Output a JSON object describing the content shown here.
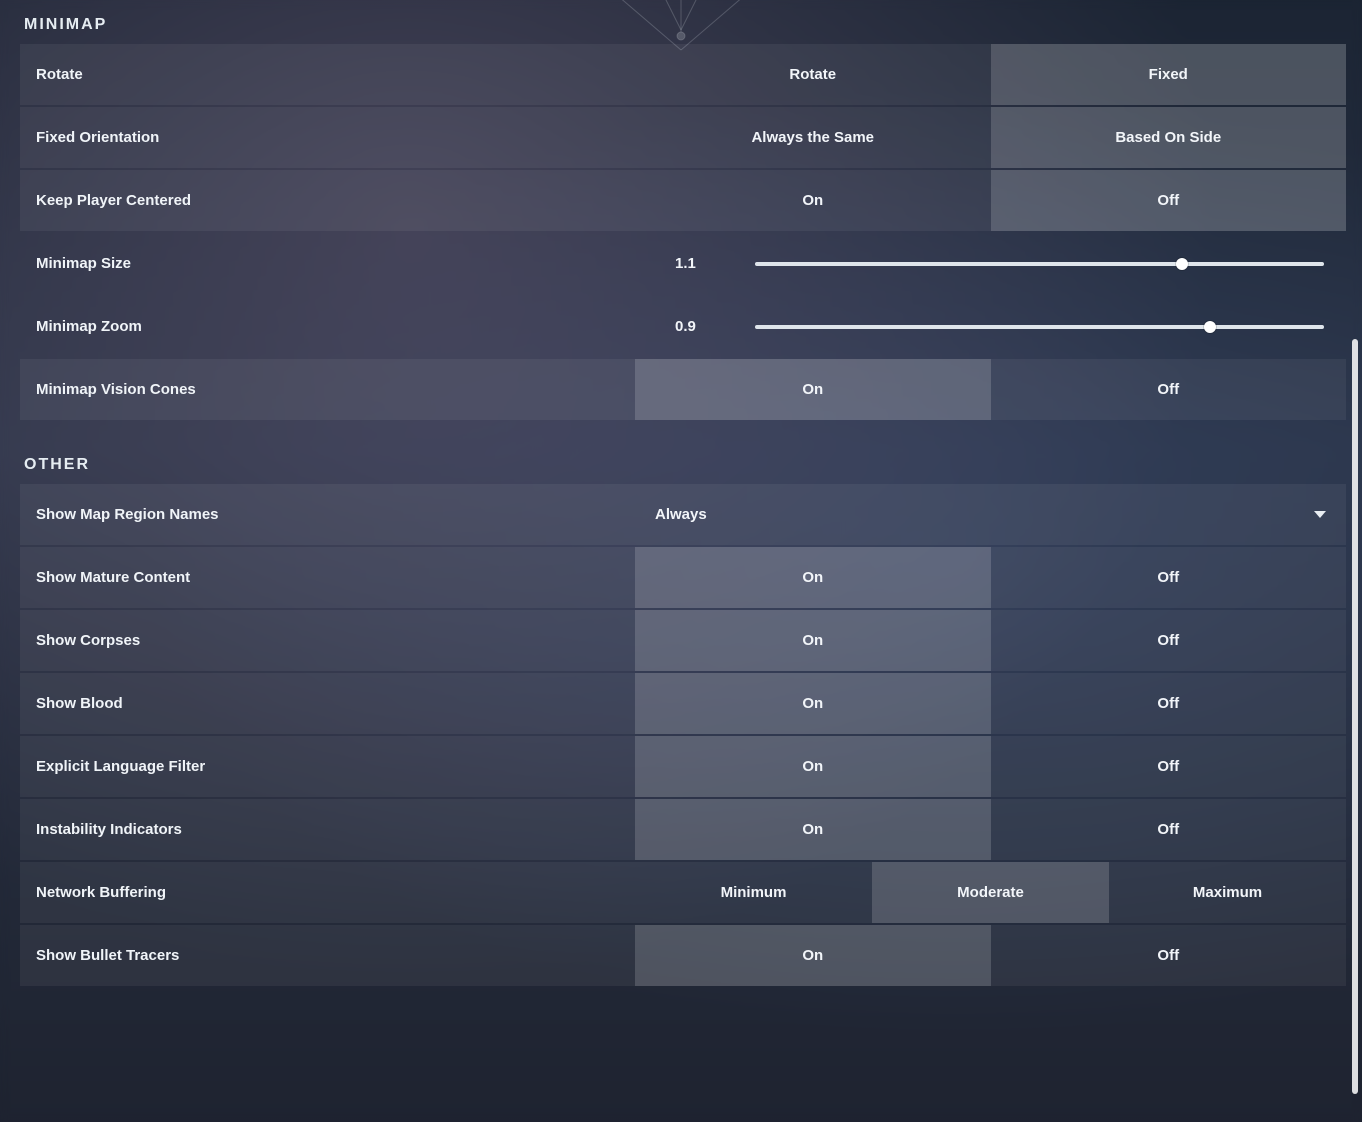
{
  "sections": {
    "minimap": {
      "title": "MINIMAP",
      "rows": {
        "rotate": {
          "label": "Rotate",
          "opt1": "Rotate",
          "opt2": "Fixed",
          "selected": "Fixed"
        },
        "fixed_orientation": {
          "label": "Fixed Orientation",
          "opt1": "Always the Same",
          "opt2": "Based On Side",
          "selected": "Based On Side"
        },
        "keep_player_centered": {
          "label": "Keep Player Centered",
          "opt1": "On",
          "opt2": "Off",
          "selected": "Off"
        },
        "minimap_size": {
          "label": "Minimap Size",
          "value": "1.1",
          "percent": 75
        },
        "minimap_zoom": {
          "label": "Minimap Zoom",
          "value": "0.9",
          "percent": 80
        },
        "vision_cones": {
          "label": "Minimap Vision Cones",
          "opt1": "On",
          "opt2": "Off",
          "selected": "On"
        }
      }
    },
    "other": {
      "title": "OTHER",
      "rows": {
        "show_region_names": {
          "label": "Show Map Region Names",
          "value": "Always"
        },
        "mature_content": {
          "label": "Show Mature Content",
          "opt1": "On",
          "opt2": "Off",
          "selected": "On"
        },
        "show_corpses": {
          "label": "Show Corpses",
          "opt1": "On",
          "opt2": "Off",
          "selected": "On"
        },
        "show_blood": {
          "label": "Show Blood",
          "opt1": "On",
          "opt2": "Off",
          "selected": "On"
        },
        "explicit_filter": {
          "label": "Explicit Language Filter",
          "opt1": "On",
          "opt2": "Off",
          "selected": "On"
        },
        "instability": {
          "label": "Instability Indicators",
          "opt1": "On",
          "opt2": "Off",
          "selected": "On"
        },
        "network_buffering": {
          "label": "Network Buffering",
          "opt1": "Minimum",
          "opt2": "Moderate",
          "opt3": "Maximum",
          "selected": "Moderate"
        },
        "bullet_tracers": {
          "label": "Show Bullet Tracers",
          "opt1": "On",
          "opt2": "Off",
          "selected": "On"
        }
      }
    }
  }
}
